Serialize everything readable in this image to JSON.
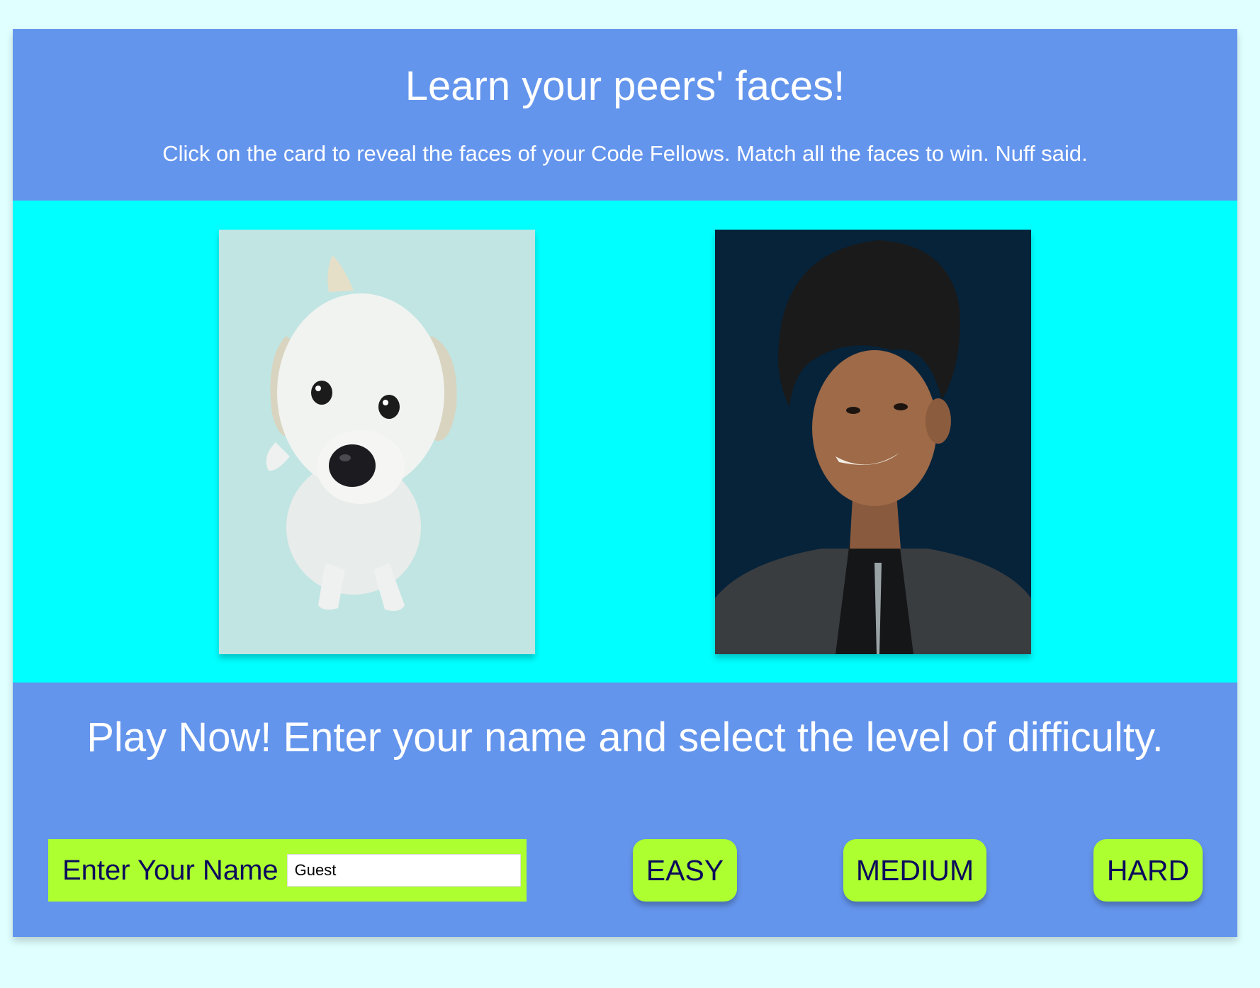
{
  "header": {
    "title": "Learn your peers' faces!",
    "instructions": "Click on the card to reveal the faces of your Code Fellows. Match all the faces to win. Nuff said."
  },
  "board": {
    "cards": [
      {
        "subject": "white dog"
      },
      {
        "subject": "smiling man in dark suit"
      }
    ]
  },
  "footer": {
    "heading": "Play Now! Enter your name and select the level of difficulty.",
    "name_label": "Enter Your Name",
    "name_value": "Guest",
    "levels": {
      "easy": "EASY",
      "medium": "MEDIUM",
      "hard": "HARD"
    }
  },
  "colors": {
    "page_background": "#e0ffff",
    "header_background": "#6495ed",
    "board_background": "#00ffff",
    "button_background": "#adff2f",
    "button_text": "#0b0b5c"
  }
}
